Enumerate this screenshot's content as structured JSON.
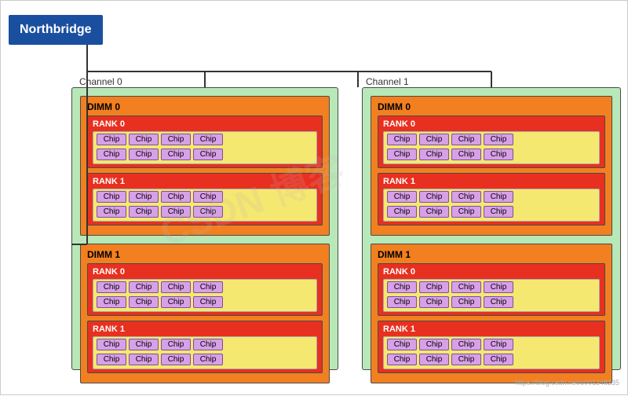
{
  "northbridge": {
    "label": "Northbridge"
  },
  "channels": [
    {
      "label": "Channel 0",
      "dimms": [
        {
          "label": "DIMM 0",
          "ranks": [
            {
              "label": "RANK 0",
              "rows": [
                [
                  "Chip",
                  "Chip",
                  "Chip",
                  "Chip"
                ],
                [
                  "Chip",
                  "Chip",
                  "Chip",
                  "Chip"
                ]
              ]
            },
            {
              "label": "RANK 1",
              "rows": [
                [
                  "Chip",
                  "Chip",
                  "Chip",
                  "Chip"
                ],
                [
                  "Chip",
                  "Chip",
                  "Chip",
                  "Chip"
                ]
              ]
            }
          ]
        },
        {
          "label": "DIMM 1",
          "ranks": [
            {
              "label": "RANK 0",
              "rows": [
                [
                  "Chip",
                  "Chip",
                  "Chip",
                  "Chip"
                ],
                [
                  "Chip",
                  "Chip",
                  "Chip",
                  "Chip"
                ]
              ]
            },
            {
              "label": "RANK 1",
              "rows": [
                [
                  "Chip",
                  "Chip",
                  "Chip",
                  "Chip"
                ],
                [
                  "Chip",
                  "Chip",
                  "Chip",
                  "Chip"
                ]
              ]
            }
          ]
        }
      ]
    },
    {
      "label": "Channel 1",
      "dimms": [
        {
          "label": "DIMM 0",
          "ranks": [
            {
              "label": "RANK 0",
              "rows": [
                [
                  "Chip",
                  "Chip",
                  "Chip",
                  "Chip"
                ],
                [
                  "Chip",
                  "Chip",
                  "Chip",
                  "Chip"
                ]
              ]
            },
            {
              "label": "RANK 1",
              "rows": [
                [
                  "Chip",
                  "Chip",
                  "Chip",
                  "Chip"
                ],
                [
                  "Chip",
                  "Chip",
                  "Chip",
                  "Chip"
                ]
              ]
            }
          ]
        },
        {
          "label": "DIMM 1",
          "ranks": [
            {
              "label": "RANK 0",
              "rows": [
                [
                  "Chip",
                  "Chip",
                  "Chip",
                  "Chip"
                ],
                [
                  "Chip",
                  "Chip",
                  "Chip",
                  "Chip"
                ]
              ]
            },
            {
              "label": "RANK 1",
              "rows": [
                [
                  "Chip",
                  "Chip",
                  "Chip",
                  "Chip"
                ],
                [
                  "Chip",
                  "Chip",
                  "Chip",
                  "Chip"
                ]
              ]
            }
          ]
        }
      ]
    }
  ],
  "watermark": "https://blog.csdn.net/u001248235"
}
